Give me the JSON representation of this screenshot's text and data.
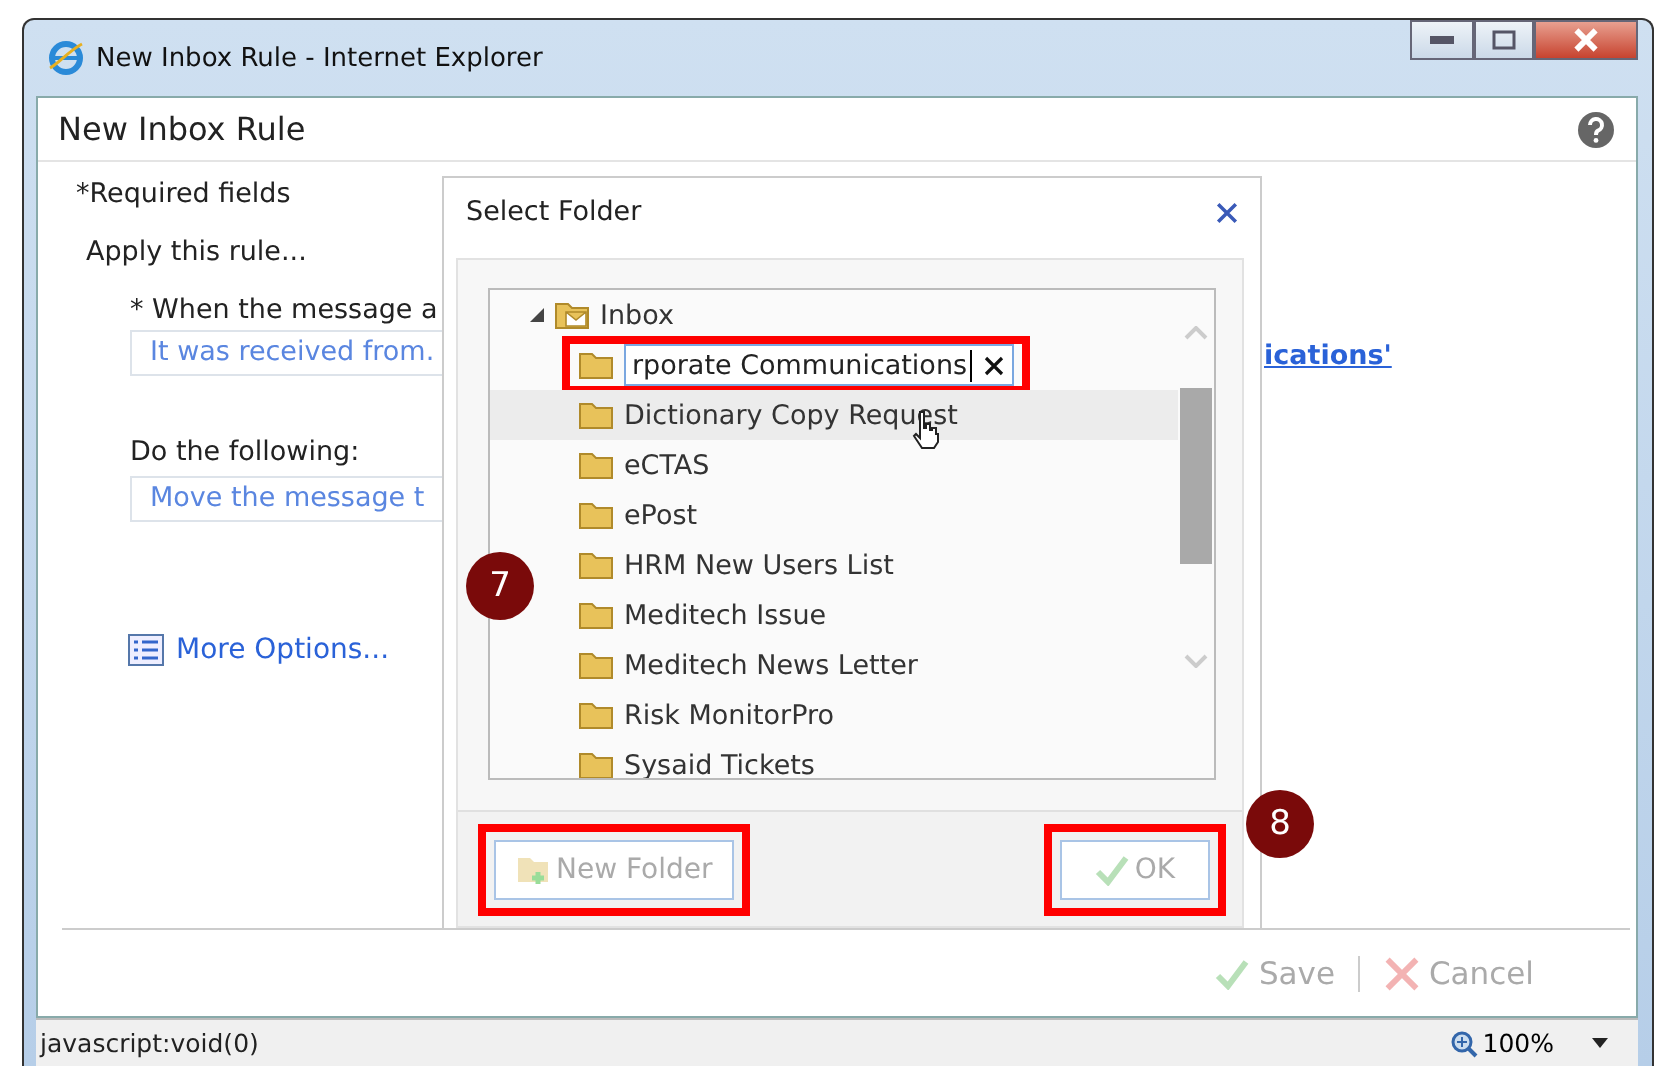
{
  "window": {
    "title": "New Inbox Rule - Internet Explorer"
  },
  "page": {
    "title": "New Inbox Rule",
    "required_note": "*Required fields",
    "apply_label": "Apply this rule...",
    "condition_label": "* When the message a",
    "condition_field": {
      "value": "It was received from."
    },
    "condition_link": "ications'",
    "action_label": "Do the following:",
    "action_field": {
      "value": "Move the message t"
    },
    "more_options": "More Options...",
    "buttons": [
      {
        "label": "Save",
        "kind": "save",
        "disabled": true
      },
      {
        "label": "Cancel",
        "kind": "cancel",
        "disabled": true
      }
    ]
  },
  "dialog": {
    "title": "Select Folder",
    "tree": {
      "label": "Inbox",
      "expanded": true,
      "children": [
        {
          "kind": "edit",
          "value": "rporate Communications",
          "selected": false,
          "highlighted": true
        },
        {
          "kind": "folder",
          "label": "Dictionary Copy Request",
          "selected": true,
          "highlighted": false
        },
        {
          "kind": "folder",
          "label": "eCTAS",
          "selected": false,
          "highlighted": false
        },
        {
          "kind": "folder",
          "label": "ePost",
          "selected": false,
          "highlighted": false
        },
        {
          "kind": "folder",
          "label": "HRM New Users List",
          "selected": false,
          "highlighted": false
        },
        {
          "kind": "folder",
          "label": "Meditech Issue",
          "selected": false,
          "highlighted": false
        },
        {
          "kind": "folder",
          "label": "Meditech News Letter",
          "selected": false,
          "highlighted": false
        },
        {
          "kind": "folder",
          "label": "Risk MonitorPro",
          "selected": false,
          "highlighted": false
        },
        {
          "kind": "folder",
          "label": "Sysaid Tickets",
          "selected": false,
          "highlighted": false
        }
      ]
    },
    "buttons": [
      {
        "label": "New Folder",
        "kind": "new",
        "disabled": true,
        "highlighted": true
      },
      {
        "label": "OK",
        "kind": "ok",
        "disabled": true,
        "highlighted": true
      }
    ]
  },
  "annotations": [
    {
      "label": "7"
    },
    {
      "label": "8"
    }
  ],
  "status_bar": {
    "url": "javascript:void(0)",
    "zoom": "100%"
  }
}
